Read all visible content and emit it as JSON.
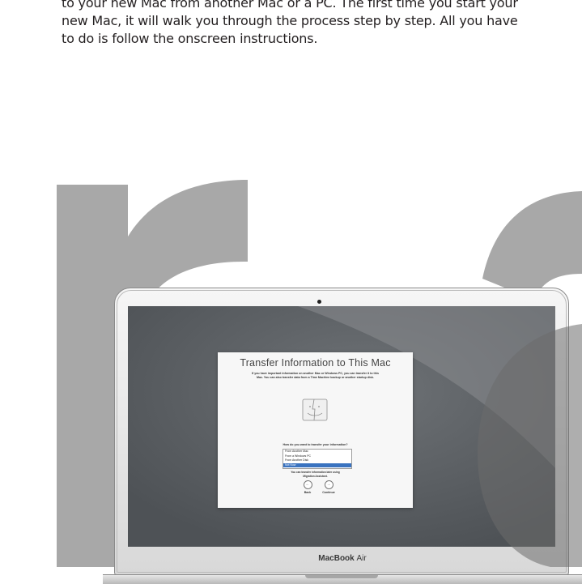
{
  "intro": {
    "line1": "to your new Mac from another Mac or a PC. The first time you start your",
    "line2": "new Mac, it will walk you through the process step by step. All you have",
    "line3": "to do is follow the onscreen instructions."
  },
  "colors": {
    "letters": "#a8a8a8",
    "screen": "#5a5e62",
    "dialog": "#f7f7f7",
    "selection": "#3a73c0"
  },
  "dialog": {
    "title": "Transfer Information to This Mac",
    "subtitle_line1": "If you have important information on another Mac or Windows PC, you can transfer it to this",
    "subtitle_line2": "Mac. You can also transfer data from a Time Machine backup or another startup disk.",
    "icon": "finder-icon",
    "question": "How do you want to transfer your information?",
    "options": [
      "From Another Mac",
      "From a Windows PC",
      "From Another Disk",
      "Not Now"
    ],
    "selected_option": "Not Now",
    "note_line1": "You can transfer information later using",
    "note_line2": "Migration Assistant.",
    "back_label": "Back",
    "continue_label": "Continue"
  },
  "laptop": {
    "brand": "MacBook",
    "model": "Air"
  }
}
